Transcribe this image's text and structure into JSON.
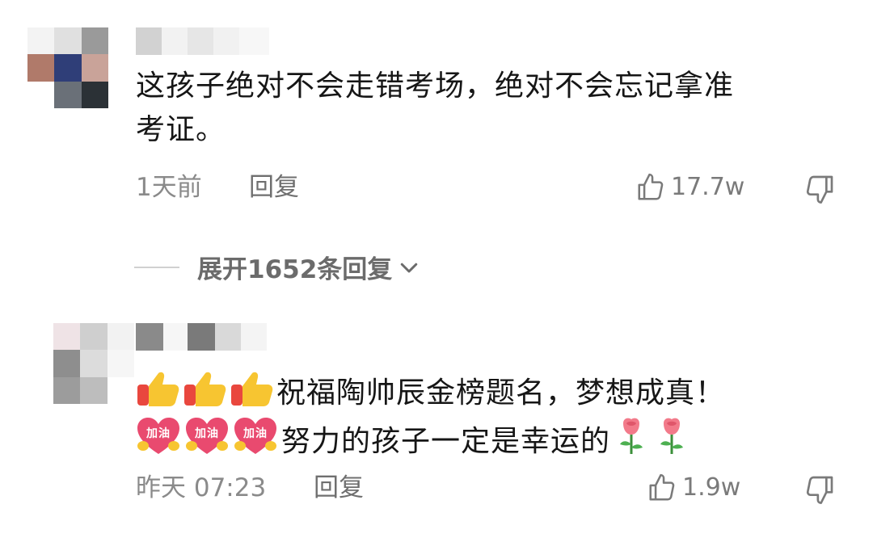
{
  "comments": [
    {
      "text_lines": [
        "这孩子绝对不会走错考场，绝对不会忘记拿准",
        "考证。"
      ],
      "time": "1天前",
      "reply_label": "回复",
      "like_count": "17.7w"
    },
    {
      "line1_text": "祝福陶帅辰金榜题名，梦想成真！",
      "line2_text": "努力的孩子一定是幸运的",
      "cheer_emoji_label": "加油",
      "time": "昨天 07:23",
      "reply_label": "回复",
      "like_count": "1.9w"
    }
  ],
  "expand_replies": "展开1652条回复",
  "colors": {
    "text": "#161616",
    "meta": "#8a8a8a",
    "icon": "#7a7a7a"
  },
  "icons": [
    "thumbs-up-icon",
    "thumbs-down-icon",
    "chevron-down-icon",
    "thumbs-up-emoji",
    "cheer-heart-emoji",
    "rose-emoji"
  ]
}
